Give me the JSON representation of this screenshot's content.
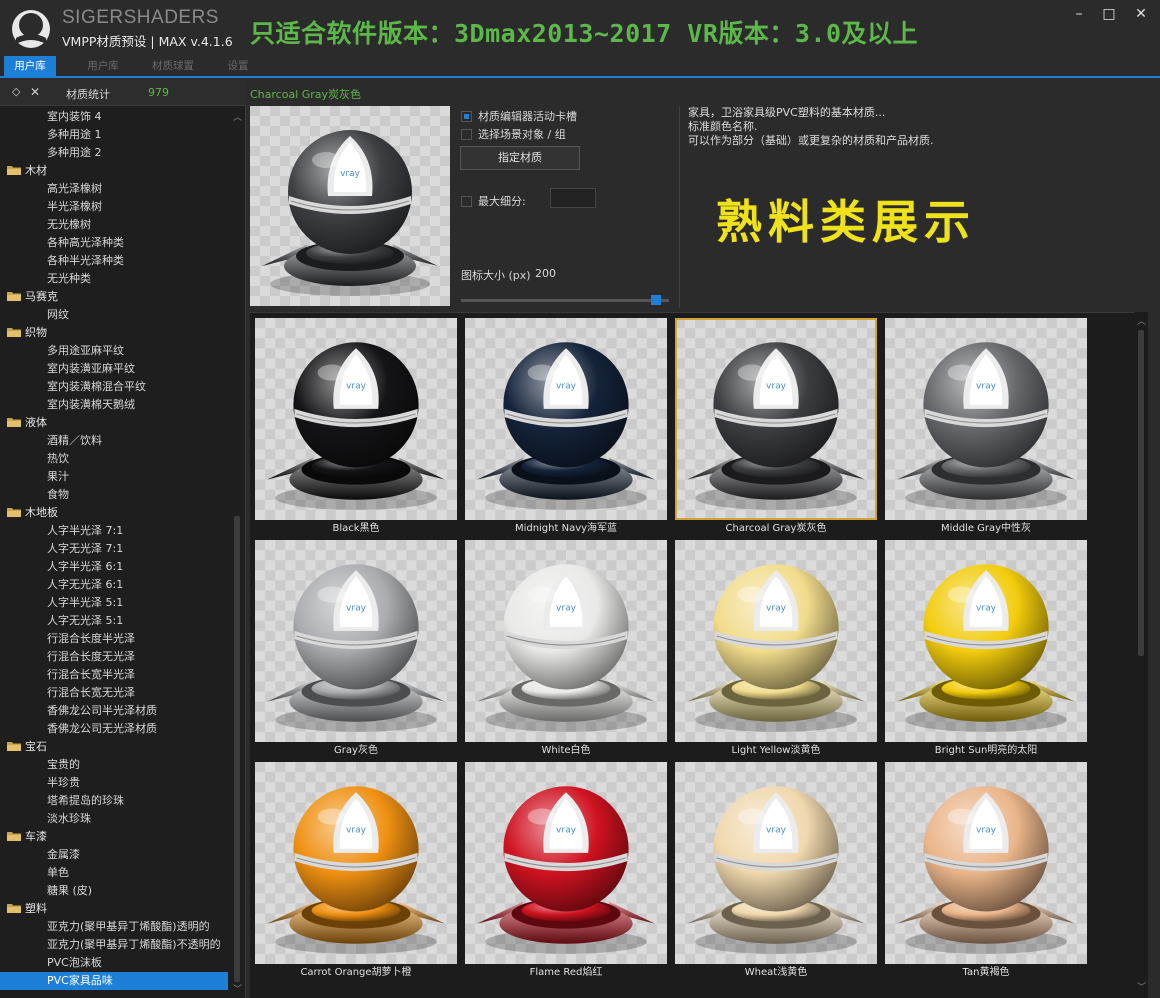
{
  "window": {
    "brand": "SIGERSHADERS",
    "subtitle": "VMPP材质预设 | MAX v.4.1.6",
    "banner": "只适合软件版本：3Dmax2013~2017  VR版本：3.0及以上",
    "controls": {
      "minimize": "–",
      "maximize": "□",
      "close": "✕"
    }
  },
  "tabs": [
    "用户库",
    "用户库",
    "材质球置",
    "设置"
  ],
  "left": {
    "stats_label": "材质统计",
    "stats_count": "979",
    "tree": [
      {
        "label": "室内装饰 4",
        "type": "item"
      },
      {
        "label": "多种用途 1",
        "type": "item"
      },
      {
        "label": "多种用途 2",
        "type": "item"
      },
      {
        "label": "木材",
        "type": "category"
      },
      {
        "label": "高光泽橡树",
        "type": "item"
      },
      {
        "label": "半光泽橡树",
        "type": "item"
      },
      {
        "label": "无光橡树",
        "type": "item"
      },
      {
        "label": "各种高光泽种类",
        "type": "item"
      },
      {
        "label": "各种半光泽种类",
        "type": "item"
      },
      {
        "label": "无光种类",
        "type": "item"
      },
      {
        "label": "马赛克",
        "type": "category"
      },
      {
        "label": "网纹",
        "type": "item"
      },
      {
        "label": "织物",
        "type": "category"
      },
      {
        "label": "多用途亚麻平纹",
        "type": "item"
      },
      {
        "label": "室内装潢亚麻平纹",
        "type": "item"
      },
      {
        "label": "室内装潢棉混合平纹",
        "type": "item"
      },
      {
        "label": "室内装潢棉天鹅绒",
        "type": "item"
      },
      {
        "label": "液体",
        "type": "category"
      },
      {
        "label": "酒精／饮料",
        "type": "item"
      },
      {
        "label": "热饮",
        "type": "item"
      },
      {
        "label": "果汁",
        "type": "item"
      },
      {
        "label": "食物",
        "type": "item"
      },
      {
        "label": "木地板",
        "type": "category"
      },
      {
        "label": "人字半光泽 7:1",
        "type": "item"
      },
      {
        "label": "人字无光泽 7:1",
        "type": "item"
      },
      {
        "label": "人字半光泽 6:1",
        "type": "item"
      },
      {
        "label": "人字无光泽 6:1",
        "type": "item"
      },
      {
        "label": "人字半光泽 5:1",
        "type": "item"
      },
      {
        "label": "人字无光泽 5:1",
        "type": "item"
      },
      {
        "label": "行混合长度半光泽",
        "type": "item"
      },
      {
        "label": "行混合长度无光泽",
        "type": "item"
      },
      {
        "label": "行混合长宽半光泽",
        "type": "item"
      },
      {
        "label": "行混合长宽无光泽",
        "type": "item"
      },
      {
        "label": "香佛龙公司半光泽材质",
        "type": "item"
      },
      {
        "label": "香佛龙公司无光泽材质",
        "type": "item"
      },
      {
        "label": "宝石",
        "type": "category"
      },
      {
        "label": "宝贵的",
        "type": "item"
      },
      {
        "label": "半珍贵",
        "type": "item"
      },
      {
        "label": "塔希提岛的珍珠",
        "type": "item"
      },
      {
        "label": "淡水珍珠",
        "type": "item"
      },
      {
        "label": "车漆",
        "type": "category"
      },
      {
        "label": "金属漆",
        "type": "item"
      },
      {
        "label": "单色",
        "type": "item"
      },
      {
        "label": "糖果 (皮)",
        "type": "item"
      },
      {
        "label": "塑料",
        "type": "category"
      },
      {
        "label": "亚克力(聚甲基异丁烯酸酯)透明的",
        "type": "item"
      },
      {
        "label": "亚克力(聚甲基异丁烯酸酯)不透明的",
        "type": "item"
      },
      {
        "label": "PVC泡沫板",
        "type": "item"
      },
      {
        "label": "PVC家具品味",
        "type": "item",
        "selected": true
      }
    ]
  },
  "preview": {
    "title": "Charcoal Gray炭灰色",
    "color": "#3d3f42",
    "opt_material_editor": "材质编辑器活动卡槽",
    "opt_select_scene": "选择场景对象 / 组",
    "assign_button": "指定材质",
    "max_subdiv_label": "最大细分:",
    "icon_size_label": "图标大小 (px)",
    "icon_size_value": "200",
    "icon_size_fraction": 0.96,
    "description": [
      "家具，卫浴家具级PVC塑料的基本材质...",
      "标准颜色名称.",
      "可以作为部分（基础）或更复杂的材质和产品材质."
    ],
    "showcase_text": "熟料类展示"
  },
  "materials": [
    {
      "name": "Black黑色",
      "color": "#141416"
    },
    {
      "name": "Midnight Navy海军蓝",
      "color": "#14233a"
    },
    {
      "name": "Charcoal Gray炭灰色",
      "color": "#3b3d40",
      "selected": true
    },
    {
      "name": "Middle Gray中性灰",
      "color": "#65676b"
    },
    {
      "name": "Gray灰色",
      "color": "#a9abae"
    },
    {
      "name": "White白色",
      "color": "#e9e9e7"
    },
    {
      "name": "Light Yellow淡黄色",
      "color": "#f1dc8c"
    },
    {
      "name": "Bright Sun明亮的太阳",
      "color": "#f2cc0c"
    },
    {
      "name": "Carrot Orange胡萝卜橙",
      "color": "#ef9012"
    },
    {
      "name": "Flame Red焰红",
      "color": "#cf1220"
    },
    {
      "name": "Wheat浅黄色",
      "color": "#f0d8ad"
    },
    {
      "name": "Tan黄褐色",
      "color": "#eab58a"
    }
  ]
}
